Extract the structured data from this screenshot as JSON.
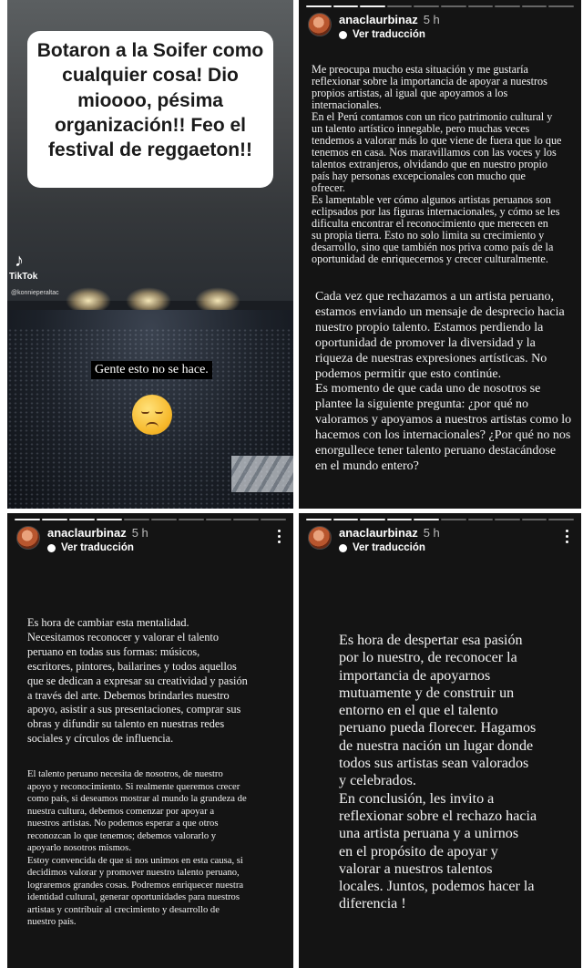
{
  "stories": [
    {
      "overlay_caption": "Botaron a la Soifer como cualquier cosa! Dio mioooo, pésima organización!! Feo el festival de reggaeton!!",
      "tiktok_label": "TikTok",
      "tiktok_user": "@konnieperaltac",
      "subtitle": "Gente esto no se hace.",
      "emoji": "pensive-face"
    },
    {
      "username": "anaclaurbinaz",
      "time": "5 h",
      "translate_label": "Ver traducción",
      "paragraph_1": "Me preocupa mucho esta situación y me gustaría\nreflexionar sobre la importancia de apoyar a nuestros\npropios artistas, al igual que apoyamos a los\ninternacionales.\nEn el Perú contamos con un rico patrimonio cultural y\nun talento artístico innegable, pero muchas veces\ntendemos a valorar más lo que viene de fuera que lo que\ntenemos en casa. Nos maravillamos con las voces y los\ntalentos extranjeros, olvidando que en nuestro propio\npaís hay personas excepcionales con mucho que\nofrecer.\nEs lamentable ver cómo algunos artistas peruanos son\neclipsados por las figuras internacionales, y cómo se les\ndificulta encontrar el reconocimiento que merecen en\nsu propia tierra. Esto no solo limita su crecimiento y\ndesarrollo, sino que también nos priva como país de la\noportunidad de enriquecernos y crecer culturalmente.",
      "paragraph_2": "Cada vez que rechazamos a un artista peruano,\nestamos enviando un mensaje de desprecio hacia\nnuestro propio talento. Estamos perdiendo la\noportunidad de promover la diversidad y la\nriqueza de nuestras expresiones artísticas. No\npodemos permitir que esto continúe.\nEs momento de que cada uno de nosotros se\nplantee la siguiente pregunta: ¿por qué no\nvaloramos y apoyamos a nuestros artistas como lo\nhacemos con los internacionales? ¿Por qué no nos\nenorgullece tener talento peruano destacándose\nen el mundo entero?"
    },
    {
      "username": "anaclaurbinaz",
      "time": "5 h",
      "translate_label": "Ver traducción",
      "paragraph_1": "Es hora de cambiar esta mentalidad.\nNecesitamos reconocer y valorar el talento\nperuano en todas sus formas: músicos,\nescritores, pintores, bailarines y todos aquellos\nque se dedican a expresar su creatividad y pasión\na través del arte. Debemos brindarles nuestro\napoyo, asistir a sus presentaciones, comprar sus\nobras y difundir su talento en nuestras redes\nsociales y círculos de influencia.",
      "paragraph_2": "El talento peruano necesita de nosotros, de nuestro\napoyo y reconocimiento. Si realmente queremos crecer\ncomo país, si deseamos mostrar al mundo la grandeza de\nnuestra cultura, debemos comenzar por apoyar a\nnuestros artistas. No podemos esperar a que otros\nreconozcan lo que tenemos; debemos valorarlo y\napoyarlo nosotros mismos.\nEstoy convencida  de que si nos unimos en esta causa, si\ndecidimos valorar y promover nuestro talento peruano,\nlograremos grandes cosas. Podremos enriquecer nuestra\nidentidad cultural, generar oportunidades para nuestros\nartistas y contribuir al crecimiento y desarrollo de\nnuestro país."
    },
    {
      "username": "anaclaurbinaz",
      "time": "5 h",
      "translate_label": "Ver traducción",
      "paragraph_1": "Es hora de despertar esa pasión\npor lo nuestro, de reconocer la\nimportancia de apoyarnos\nmutuamente y de construir un\nentorno en el que el talento\nperuano pueda florecer. Hagamos\nde nuestra nación un lugar donde\ntodos sus artistas sean valorados\ny celebrados.\nEn conclusión, les invito a\nreflexionar sobre el rechazo hacia\nuna artista peruana y a unirnos\nen el propósito de apoyar y\nvalorar a nuestros talentos\nlocales. Juntos, podemos hacer la\ndiferencia !"
    }
  ]
}
